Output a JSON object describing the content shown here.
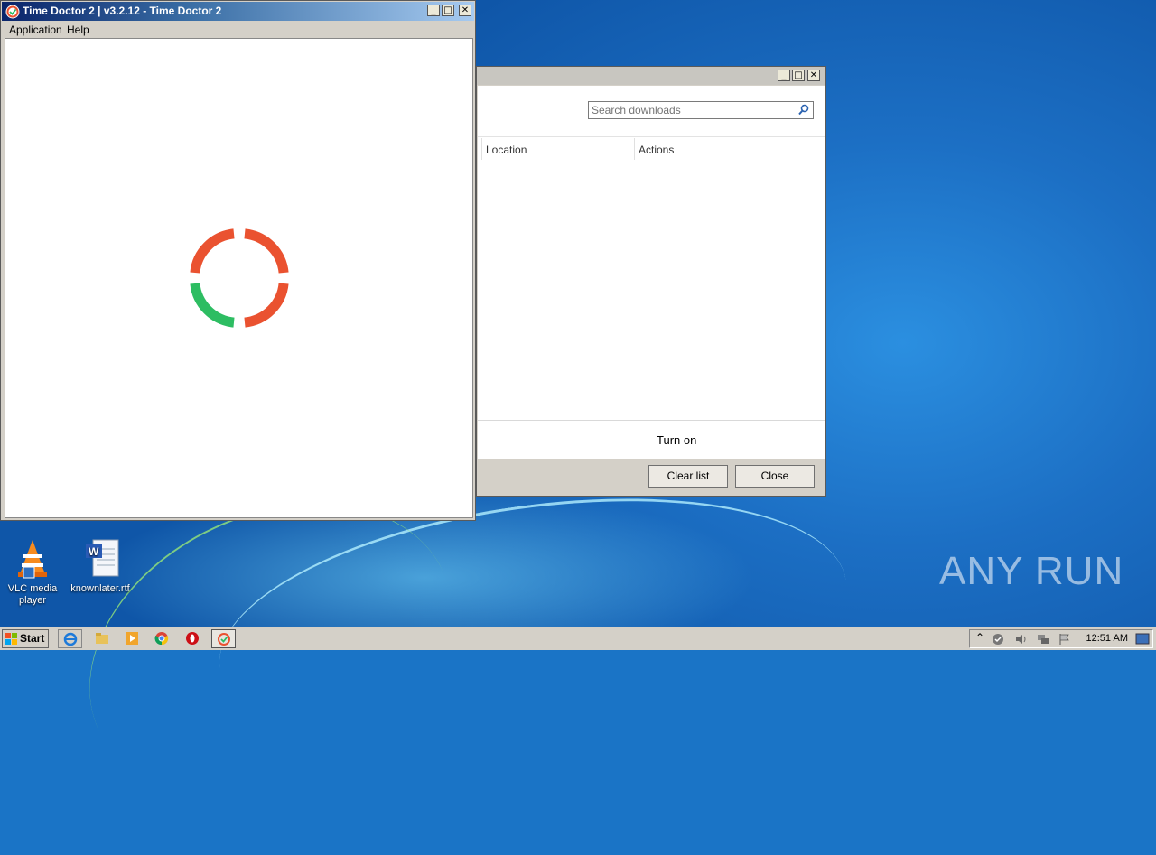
{
  "desktop": {
    "icons": [
      {
        "label": "VLC media player"
      },
      {
        "label": "knownlater.rtf"
      }
    ],
    "watermark": "ANY RUN"
  },
  "time_doctor_window": {
    "title": "Time Doctor 2 | v3.2.12 - Time Doctor 2",
    "menu": [
      "Application",
      "Help"
    ],
    "spinner_colors": {
      "orange": "#ea5230",
      "green": "#2dbd62"
    }
  },
  "downloads_window": {
    "search_placeholder": "Search downloads",
    "columns": [
      "Location",
      "Actions"
    ],
    "turn_on_label": "Turn on",
    "buttons": {
      "clear_list": "Clear list",
      "close": "Close"
    }
  },
  "window_controls": {
    "minimize": "_",
    "maximize": "□",
    "close": "✕"
  },
  "taskbar": {
    "start_label": "Start",
    "clock": "12:51 AM"
  }
}
